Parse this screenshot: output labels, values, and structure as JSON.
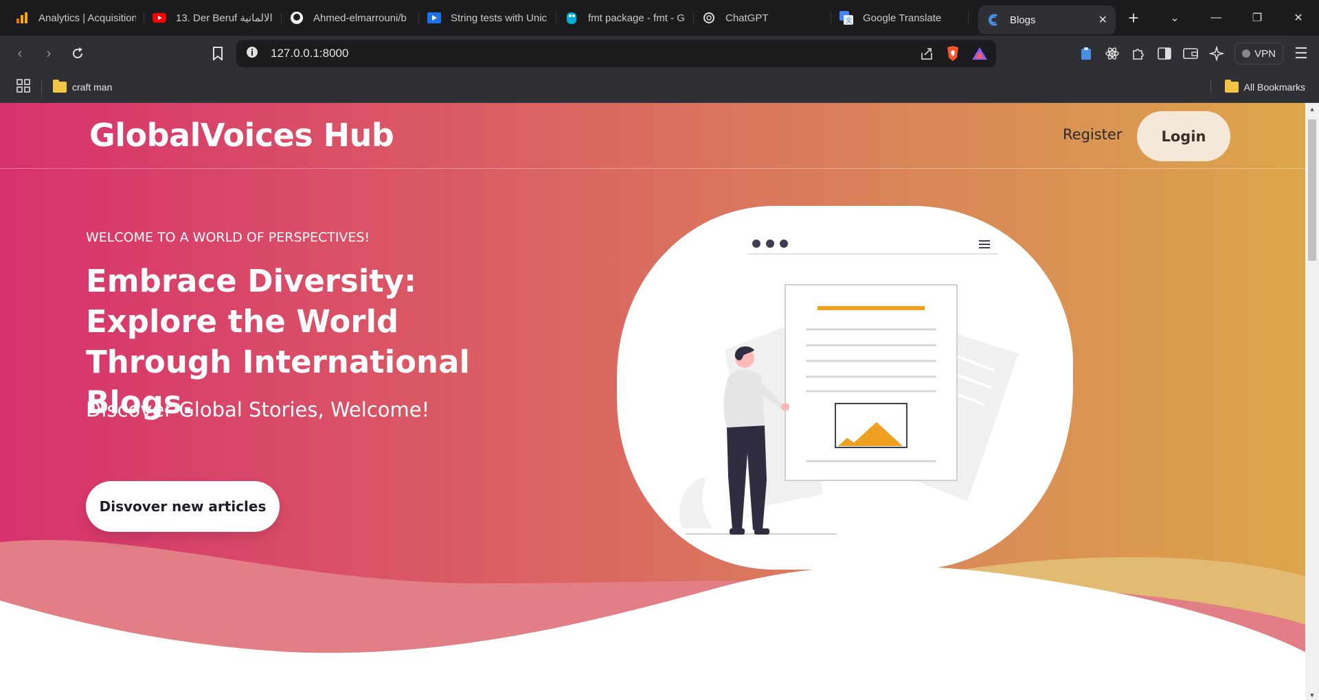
{
  "browser": {
    "tabs": [
      {
        "title": "Analytics | Acquisition",
        "icon": "analytics-icon",
        "color": "#f9ab00"
      },
      {
        "title": "13. Der Beruf الالمانية",
        "icon": "youtube-icon",
        "color": "#ff0000"
      },
      {
        "title": "Ahmed-elmarrouni/b",
        "icon": "github-icon",
        "color": "#ffffff"
      },
      {
        "title": "String tests with Unic",
        "icon": "video-icon",
        "color": "#1a73e8"
      },
      {
        "title": "fmt package - fmt - G",
        "icon": "go-gopher-icon",
        "color": "#00add8"
      },
      {
        "title": "ChatGPT",
        "icon": "chatgpt-icon",
        "color": "#ffffff"
      },
      {
        "title": "Google Translate",
        "icon": "translate-icon",
        "color": "#4285f4"
      },
      {
        "title": "Blogs",
        "icon": "blog-icon",
        "color": "#4a90e2"
      }
    ],
    "new_tab_label": "+",
    "url": "127.0.0.1:8000",
    "vpn_label": "VPN",
    "bookmarks": {
      "folder_label": "craft man",
      "all_label": "All Bookmarks"
    }
  },
  "site": {
    "brand": "GlobalVoices Hub",
    "nav": {
      "register_label": "Register",
      "login_label": "Login"
    },
    "hero": {
      "kicker": "WELCOME TO A WORLD OF PERSPECTIVES!",
      "headline": "Embrace Diversity: Explore the World Through International Blogs.",
      "subline": "Discover Global Stories, Welcome!",
      "cta_label": "Disvover new articles"
    },
    "colors": {
      "gradient_start": "#d7316d",
      "gradient_end": "#dca64a",
      "accent": "#f0a020",
      "login_bg": "#f6e8d8"
    }
  }
}
